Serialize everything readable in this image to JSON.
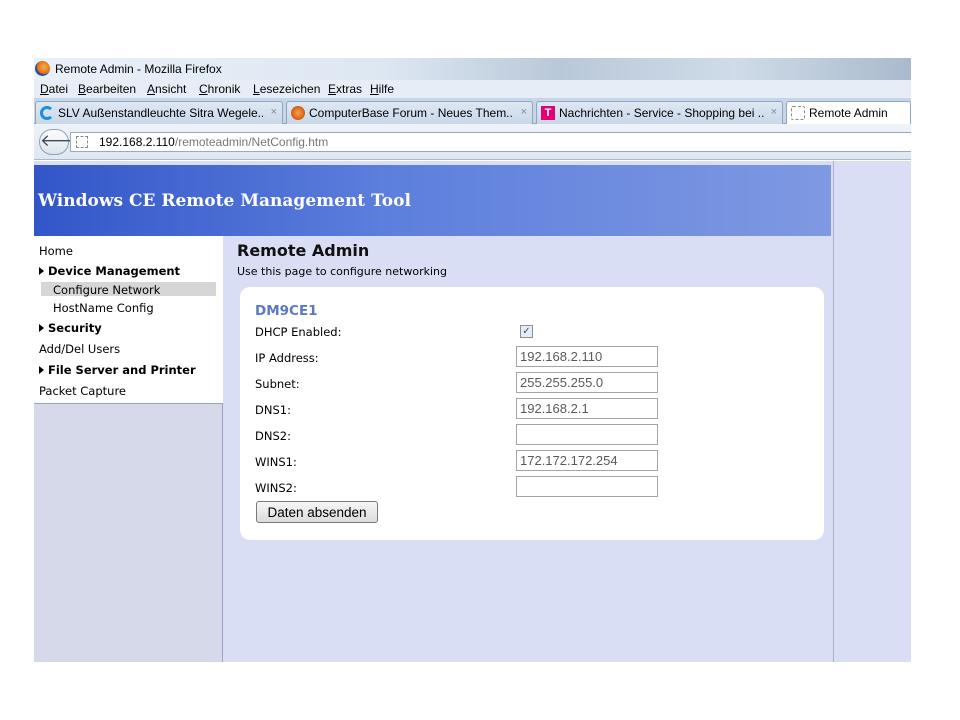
{
  "window": {
    "title": "Remote Admin - Mozilla Firefox"
  },
  "menu": [
    "Datei",
    "Bearbeiten",
    "Ansicht",
    "Chronik",
    "Lesezeichen",
    "Extras",
    "Hilfe"
  ],
  "tabs": [
    {
      "label": "SLV Außenstandleuchte Sitra Wegele...",
      "icon": "c-icon",
      "close": "×"
    },
    {
      "label": "ComputerBase Forum - Neues Them...",
      "icon": "computerbase-icon",
      "close": "×"
    },
    {
      "label": "Nachrichten - Service - Shopping bei ...",
      "icon": "telekom-icon",
      "glyph": "T",
      "close": "×"
    },
    {
      "label": "Remote Admin",
      "icon": "blank-page-icon",
      "active": true
    }
  ],
  "nav": {
    "back_glyph": "🡐",
    "url_host": "192.168.2.110",
    "url_path": "/remoteadmin/NetConfig.htm"
  },
  "banner": {
    "title": "Windows CE Remote Management Tool"
  },
  "sidebar": {
    "home": "Home",
    "device_management": "Device Management",
    "configure_network": "Configure Network",
    "hostname_config": "HostName Config",
    "security": "Security",
    "add_del_users": "Add/Del Users",
    "file_server": "File Server and Printer",
    "packet_capture": "Packet Capture"
  },
  "main": {
    "title": "Remote Admin",
    "description": "Use this page to configure networking",
    "device": "DM9CE1",
    "dhcp": {
      "label": "DHCP Enabled:",
      "checked": true,
      "check_glyph": "✓"
    },
    "fields": [
      {
        "label": "IP Address:",
        "value": "192.168.2.110"
      },
      {
        "label": "Subnet:",
        "value": "255.255.255.0"
      },
      {
        "label": "DNS1:",
        "value": "192.168.2.1"
      },
      {
        "label": "DNS2:",
        "value": ""
      },
      {
        "label": "WINS1:",
        "value": "172.172.172.254"
      },
      {
        "label": "WINS2:",
        "value": ""
      }
    ],
    "submit_label": "Daten absenden"
  }
}
